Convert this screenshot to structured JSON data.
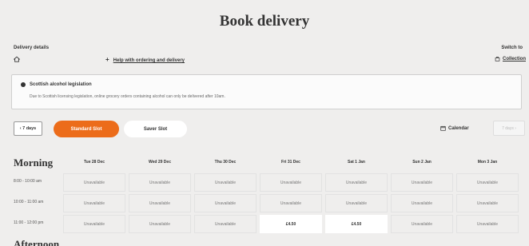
{
  "page_title": "Book delivery",
  "delivery": {
    "label": "Delivery details",
    "home_icon": "home-icon",
    "help_link": "Help with ordering and delivery"
  },
  "switch": {
    "label": "Switch to",
    "collection": "Collection",
    "collection_icon": "shopping-bag-icon"
  },
  "notice": {
    "icon": "info-icon",
    "title": "Scottish alcohol legislation",
    "body": "Due to Scottish licensing legislation, online grocery orders containing alcohol can only be delivered after 10am."
  },
  "controls": {
    "prev_days": "‹ 7 days",
    "tabs": [
      {
        "label": "Standard Slot",
        "active": true
      },
      {
        "label": "Saver Slot",
        "active": false
      }
    ],
    "calendar": "Calendar",
    "next_days": "7 days ›"
  },
  "colors": {
    "accent": "#ec6c1a",
    "background": "#efeeed"
  },
  "days": [
    "Tue 28 Dec",
    "Wed 29 Dec",
    "Thu 30 Dec",
    "Fri 31 Dec",
    "Sat 1 Jan",
    "Sun 2 Jan",
    "Mon 3 Jan"
  ],
  "sections": [
    {
      "heading": "Morning",
      "rows": [
        {
          "time": "8:00 - 10:00 am",
          "cells": [
            "Unavailable",
            "Unavailable",
            "Unavailable",
            "Unavailable",
            "Unavailable",
            "Unavailable",
            "Unavailable"
          ]
        },
        {
          "time": "10:00 - 11:00 am",
          "cells": [
            "Unavailable",
            "Unavailable",
            "Unavailable",
            "Unavailable",
            "Unavailable",
            "Unavailable",
            "Unavailable"
          ]
        },
        {
          "time": "11:00 - 12:00 pm",
          "cells": [
            "Unavailable",
            "Unavailable",
            "Unavailable",
            "£4.50",
            "£4.50",
            "Unavailable",
            "Unavailable"
          ]
        }
      ]
    },
    {
      "heading": "Afternoon",
      "rows": []
    }
  ]
}
